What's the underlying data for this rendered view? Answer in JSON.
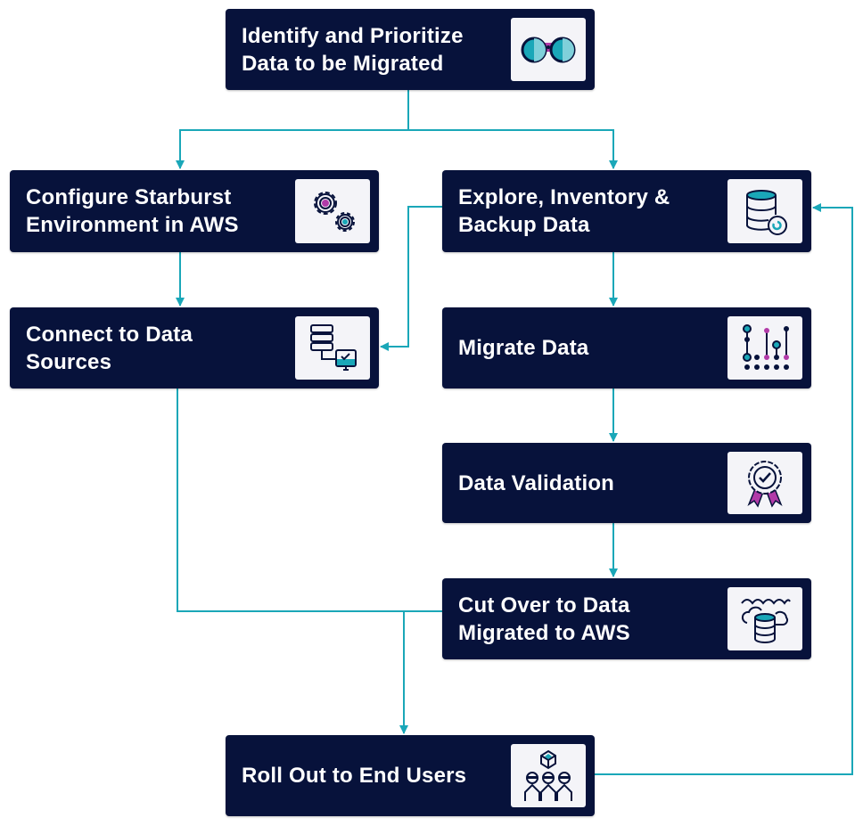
{
  "diagram": {
    "type": "flowchart",
    "colors": {
      "node_fill": "#07123b",
      "node_text": "#ffffff",
      "icon_bg": "#f4f4f8",
      "connector": "#1aa7b8",
      "accent_teal": "#1aa7b8",
      "accent_magenta": "#b23aa8"
    },
    "nodes": {
      "identify": {
        "label": "Identify and Prioritize\nData to be Migrated",
        "icon": "binoculars-icon"
      },
      "configure": {
        "label": "Configure Starburst\nEnvironment in AWS",
        "icon": "gears-icon"
      },
      "explore": {
        "label": "Explore, Inventory &\nBackup Data",
        "icon": "database-backup-icon"
      },
      "connect": {
        "label": "Connect to Data\nSources",
        "icon": "server-monitor-icon"
      },
      "migrate": {
        "label": "Migrate Data",
        "icon": "data-sliders-icon"
      },
      "validate": {
        "label": "Data Validation",
        "icon": "award-badge-icon"
      },
      "cutover": {
        "label": "Cut Over to Data\nMigrated to AWS",
        "icon": "cloud-database-icon"
      },
      "rollout": {
        "label": "Roll Out to End Users",
        "icon": "users-cube-icon"
      }
    },
    "edges": [
      {
        "from": "identify",
        "to": "configure"
      },
      {
        "from": "identify",
        "to": "explore"
      },
      {
        "from": "configure",
        "to": "connect"
      },
      {
        "from": "explore",
        "to": "connect"
      },
      {
        "from": "explore",
        "to": "migrate"
      },
      {
        "from": "migrate",
        "to": "validate"
      },
      {
        "from": "validate",
        "to": "cutover"
      },
      {
        "from": "connect",
        "to": "rollout"
      },
      {
        "from": "cutover",
        "to": "rollout"
      },
      {
        "from": "rollout",
        "to": "explore"
      }
    ]
  }
}
